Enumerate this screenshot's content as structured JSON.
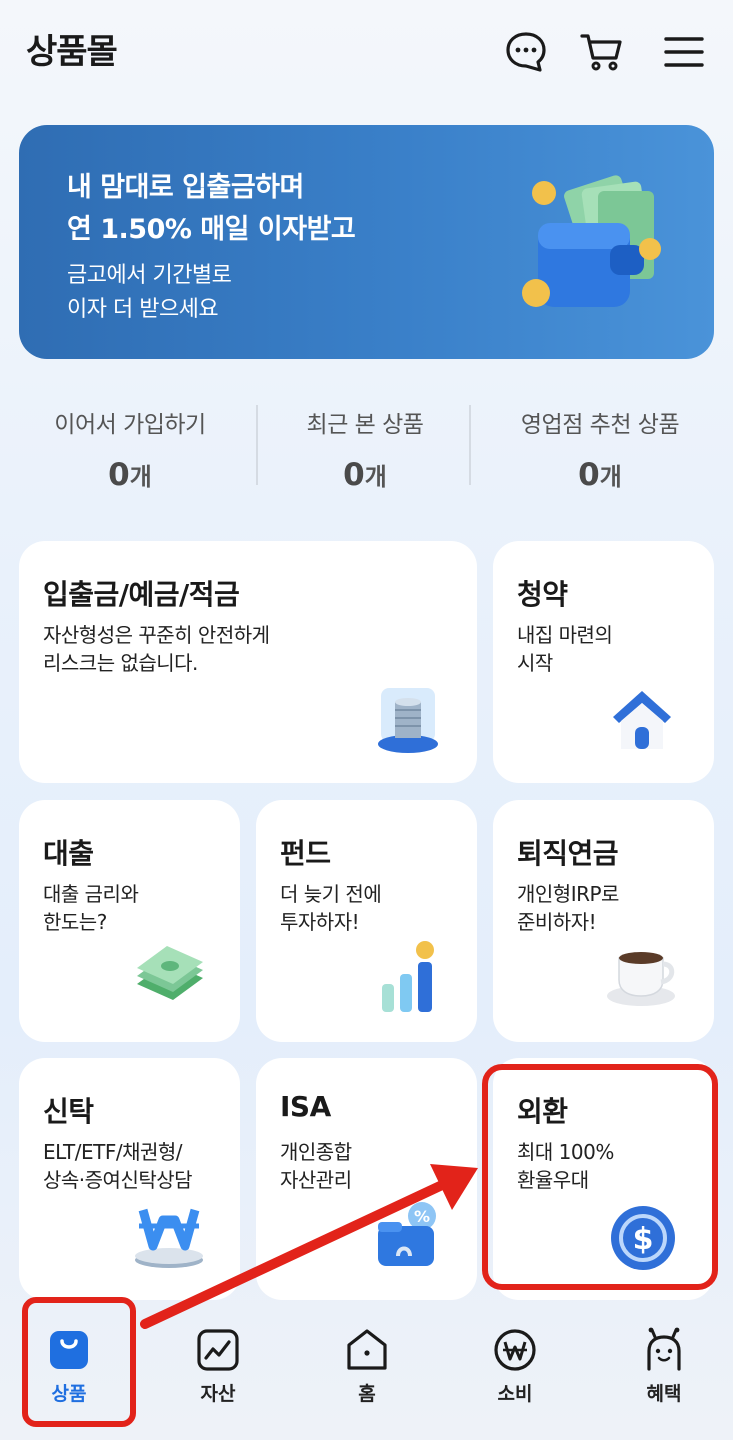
{
  "header": {
    "title": "상품몰",
    "icons": [
      "chat-icon",
      "cart-icon",
      "menu-icon"
    ]
  },
  "banner": {
    "line1": "내 맘대로 입출금하며",
    "line2": "연 1.50% 매일 이자받고",
    "line3": "금고에서 기간별로",
    "line4": "이자 더 받으세요"
  },
  "stats": [
    {
      "label": "이어서 가입하기",
      "value": "0",
      "unit": "개"
    },
    {
      "label": "최근 본 상품",
      "value": "0",
      "unit": "개"
    },
    {
      "label": "영업점 추천 상품",
      "value": "0",
      "unit": "개"
    }
  ],
  "cards": {
    "deposit": {
      "title": "입출금/예금/적금",
      "desc1": "자산형성은 꾸준히 안전하게",
      "desc2": "리스크는 없습니다."
    },
    "subscription": {
      "title": "청약",
      "desc1": "내집 마련의",
      "desc2": "시작"
    },
    "loan": {
      "title": "대출",
      "desc1": "대출 금리와",
      "desc2": "한도는?"
    },
    "fund": {
      "title": "펀드",
      "desc1": "더 늦기 전에",
      "desc2": "투자하자!"
    },
    "pension": {
      "title": "퇴직연금",
      "desc1": "개인형IRP로",
      "desc2": "준비하자!"
    },
    "trust": {
      "title": "신탁",
      "desc1": "ELT/ETF/채권형/",
      "desc2": "상속·증여신탁상담"
    },
    "isa": {
      "title": "ISA",
      "desc1": "개인종합",
      "desc2": "자산관리"
    },
    "forex": {
      "title": "외환",
      "desc1": "최대 100%",
      "desc2": "환율우대"
    }
  },
  "tabbar": {
    "active": "상품",
    "items": [
      {
        "label": "상품",
        "icon": "shopping-bag-icon"
      },
      {
        "label": "자산",
        "icon": "chart-icon"
      },
      {
        "label": "홈",
        "icon": "home-icon"
      },
      {
        "label": "소비",
        "icon": "won-icon"
      },
      {
        "label": "혜택",
        "icon": "character-icon"
      }
    ]
  },
  "colors": {
    "accent": "#1f6fe0",
    "banner": "#3a80c9",
    "annotation": "#e2231a"
  }
}
